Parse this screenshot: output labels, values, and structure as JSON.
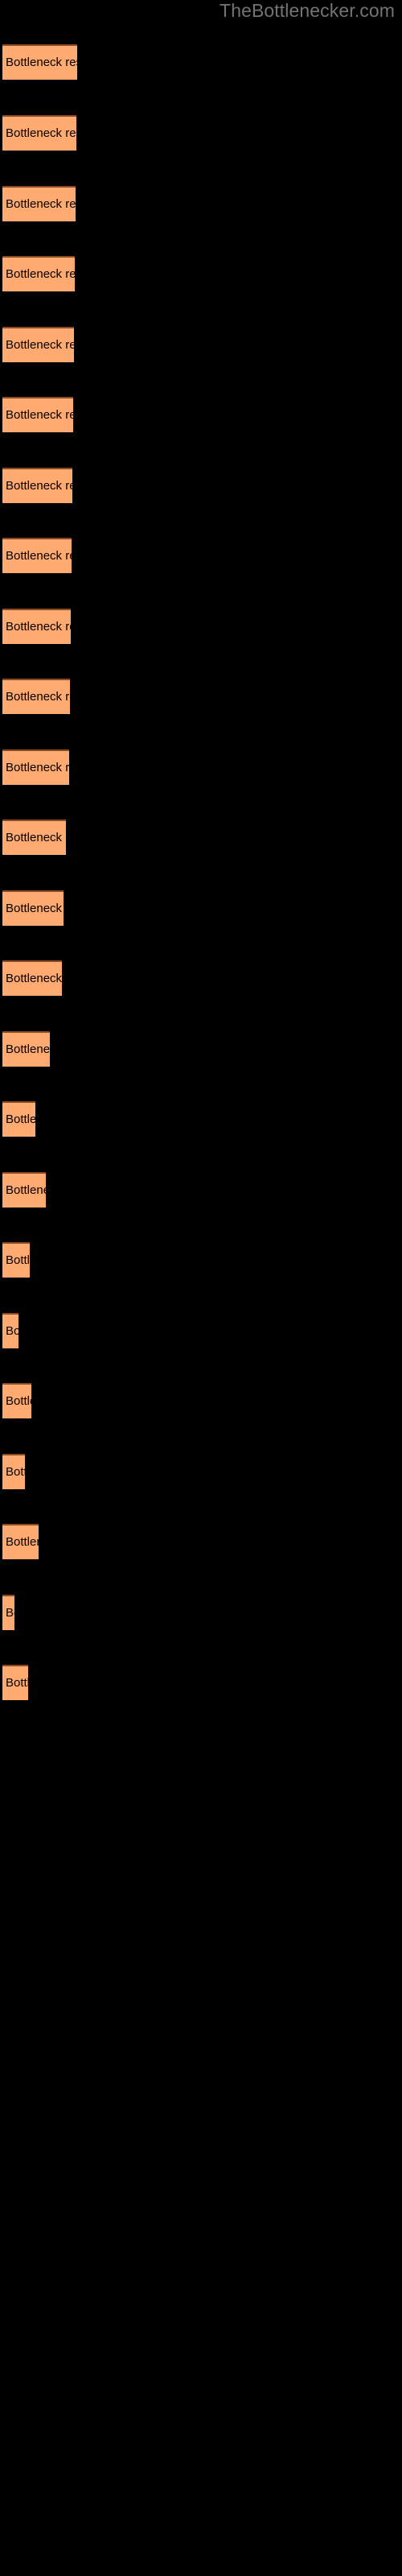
{
  "watermark": {
    "text": "TheBottlenecker.com",
    "color": "#737373"
  },
  "background_color": "#000000",
  "bar_color": "#ffaa71",
  "bar_border_color": "#8a4a22",
  "bar_label_color": "#000000",
  "bars": [
    {
      "label": "Bottleneck result",
      "width": 93,
      "top": 55
    },
    {
      "label": "Bottleneck result",
      "width": 92,
      "top": 143
    },
    {
      "label": "Bottleneck result",
      "width": 91,
      "top": 231
    },
    {
      "label": "Bottleneck result",
      "width": 90,
      "top": 318
    },
    {
      "label": "Bottleneck result",
      "width": 89,
      "top": 406
    },
    {
      "label": "Bottleneck result",
      "width": 88,
      "top": 493
    },
    {
      "label": "Bottleneck result",
      "width": 87,
      "top": 581
    },
    {
      "label": "Bottleneck result",
      "width": 86,
      "top": 668
    },
    {
      "label": "Bottleneck result",
      "width": 85,
      "top": 756
    },
    {
      "label": "Bottleneck result",
      "width": 84,
      "top": 843
    },
    {
      "label": "Bottleneck result",
      "width": 83,
      "top": 931
    },
    {
      "label": "Bottleneck result",
      "width": 79,
      "top": 1018
    },
    {
      "label": "Bottleneck result",
      "width": 76,
      "top": 1106
    },
    {
      "label": "Bottleneck result",
      "width": 74,
      "top": 1193
    },
    {
      "label": "Bottleneck result",
      "width": 59,
      "top": 1281
    },
    {
      "label": "Bottleneck result",
      "width": 41,
      "top": 1368
    },
    {
      "label": "Bottleneck result",
      "width": 54,
      "top": 1456
    },
    {
      "label": "Bottleneck result",
      "width": 34,
      "top": 1543
    },
    {
      "label": "Bottleneck result",
      "width": 20,
      "top": 1631
    },
    {
      "label": "Bottleneck result",
      "width": 36,
      "top": 1718
    },
    {
      "label": "Bottleneck result",
      "width": 28,
      "top": 1806
    },
    {
      "label": "Bottleneck result",
      "width": 45,
      "top": 1893
    },
    {
      "label": "Bottleneck result",
      "width": 15,
      "top": 1981
    },
    {
      "label": "Bottleneck result",
      "width": 32,
      "top": 2068
    }
  ],
  "chart_data": {
    "type": "bar",
    "orientation": "horizontal",
    "title": "",
    "xlabel": "",
    "ylabel": "",
    "grid": false,
    "legend": false,
    "bar_color": "#ffaa71",
    "background": "#000000",
    "categories": [
      "Bottleneck result 1",
      "Bottleneck result 2",
      "Bottleneck result 3",
      "Bottleneck result 4",
      "Bottleneck result 5",
      "Bottleneck result 6",
      "Bottleneck result 7",
      "Bottleneck result 8",
      "Bottleneck result 9",
      "Bottleneck result 10",
      "Bottleneck result 11",
      "Bottleneck result 12",
      "Bottleneck result 13",
      "Bottleneck result 14",
      "Bottleneck result 15",
      "Bottleneck result 16",
      "Bottleneck result 17",
      "Bottleneck result 18",
      "Bottleneck result 19",
      "Bottleneck result 20",
      "Bottleneck result 21",
      "Bottleneck result 22",
      "Bottleneck result 23",
      "Bottleneck result 24"
    ],
    "values": [
      93,
      92,
      91,
      90,
      89,
      88,
      87,
      86,
      85,
      84,
      83,
      79,
      76,
      74,
      59,
      41,
      54,
      34,
      20,
      36,
      28,
      45,
      15,
      32
    ],
    "bar_labels": [
      "Bottleneck result",
      "Bottleneck result",
      "Bottleneck result",
      "Bottleneck result",
      "Bottleneck result",
      "Bottleneck result",
      "Bottleneck result",
      "Bottleneck result",
      "Bottleneck result",
      "Bottleneck result",
      "Bottleneck result",
      "Bottleneck result",
      "Bottleneck result",
      "Bottleneck result",
      "Bottleneck result",
      "Bottleneck result",
      "Bottleneck result",
      "Bottleneck result",
      "Bottleneck result",
      "Bottleneck result",
      "Bottleneck result",
      "Bottleneck result",
      "Bottleneck result",
      "Bottleneck result"
    ],
    "xlim": [
      0,
      500
    ],
    "ylim": null
  }
}
